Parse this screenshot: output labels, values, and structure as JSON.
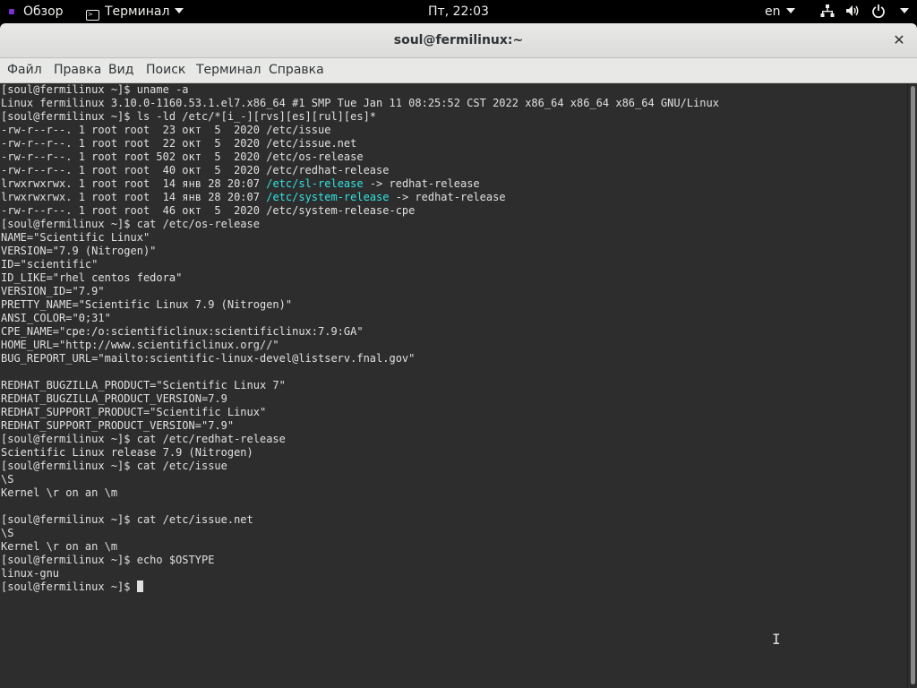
{
  "topbar": {
    "activities_label": "Обзор",
    "app_menu_label": "Терминал",
    "clock": "Пт, 22:03",
    "language": "en",
    "icons": [
      "network-icon",
      "volume-icon",
      "power-icon"
    ]
  },
  "window": {
    "title": "soul@fermilinux:~",
    "close_glyph": "✕"
  },
  "menubar": {
    "items": [
      "Файл",
      "Правка",
      "Вид",
      "Поиск",
      "Терминал",
      "Справка"
    ]
  },
  "terminal": {
    "colors": {
      "background": "#2d2d2d",
      "foreground": "#e0e0e0",
      "link": "#34e2e2"
    },
    "lines": [
      "[soul@fermilinux ~]$ uname -a",
      "Linux fermilinux 3.10.0-1160.53.1.el7.x86_64 #1 SMP Tue Jan 11 08:25:52 CST 2022 x86_64 x86_64 x86_64 GNU/Linux",
      "[soul@fermilinux ~]$ ls -ld /etc/*[i_-][rvs][es][rul][es]*",
      "-rw-r--r--. 1 root root  23 окт  5  2020 /etc/issue",
      "-rw-r--r--. 1 root root  22 окт  5  2020 /etc/issue.net",
      "-rw-r--r--. 1 root root 502 окт  5  2020 /etc/os-release",
      "-rw-r--r--. 1 root root  40 окт  5  2020 /etc/redhat-release",
      {
        "pre": "lrwxrwxrwx. 1 root root  14 янв 28 20:07 ",
        "link": "/etc/sl-release",
        "post": " -> redhat-release"
      },
      {
        "pre": "lrwxrwxrwx. 1 root root  14 янв 28 20:07 ",
        "link": "/etc/system-release",
        "post": " -> redhat-release"
      },
      "-rw-r--r--. 1 root root  46 окт  5  2020 /etc/system-release-cpe",
      "[soul@fermilinux ~]$ cat /etc/os-release",
      "NAME=\"Scientific Linux\"",
      "VERSION=\"7.9 (Nitrogen)\"",
      "ID=\"scientific\"",
      "ID_LIKE=\"rhel centos fedora\"",
      "VERSION_ID=\"7.9\"",
      "PRETTY_NAME=\"Scientific Linux 7.9 (Nitrogen)\"",
      "ANSI_COLOR=\"0;31\"",
      "CPE_NAME=\"cpe:/o:scientificlinux:scientificlinux:7.9:GA\"",
      "HOME_URL=\"http://www.scientificlinux.org//\"",
      "BUG_REPORT_URL=\"mailto:scientific-linux-devel@listserv.fnal.gov\"",
      "",
      "REDHAT_BUGZILLA_PRODUCT=\"Scientific Linux 7\"",
      "REDHAT_BUGZILLA_PRODUCT_VERSION=7.9",
      "REDHAT_SUPPORT_PRODUCT=\"Scientific Linux\"",
      "REDHAT_SUPPORT_PRODUCT_VERSION=\"7.9\"",
      "[soul@fermilinux ~]$ cat /etc/redhat-release",
      "Scientific Linux release 7.9 (Nitrogen)",
      "[soul@fermilinux ~]$ cat /etc/issue",
      "\\S",
      "Kernel \\r on an \\m",
      "",
      "[soul@fermilinux ~]$ cat /etc/issue.net",
      "\\S",
      "Kernel \\r on an \\m",
      "[soul@fermilinux ~]$ echo $OSTYPE",
      "linux-gnu"
    ],
    "prompt": "[soul@fermilinux ~]$ "
  }
}
